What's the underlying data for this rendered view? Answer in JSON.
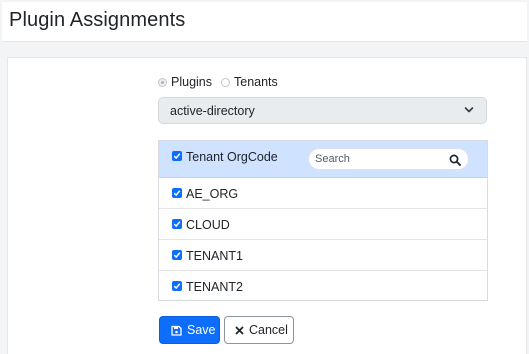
{
  "header": {
    "title": "Plugin Assignments"
  },
  "mode": {
    "options": [
      {
        "label": "Plugins",
        "checked": true
      },
      {
        "label": "Tenants",
        "checked": false
      }
    ]
  },
  "plugin_select": {
    "value": "active-directory"
  },
  "table": {
    "header_label": "Tenant OrgCode",
    "search": {
      "placeholder": "Search",
      "value": ""
    },
    "rows": [
      {
        "label": "AE_ORG",
        "checked": true
      },
      {
        "label": "CLOUD",
        "checked": true
      },
      {
        "label": "TENANT1",
        "checked": true
      },
      {
        "label": "TENANT2",
        "checked": true
      }
    ]
  },
  "actions": {
    "save_label": "Save",
    "cancel_label": "Cancel"
  },
  "colors": {
    "primary": "#0d6efd",
    "header_row": "#cfe2ff",
    "select_bg": "#e9ecef"
  }
}
